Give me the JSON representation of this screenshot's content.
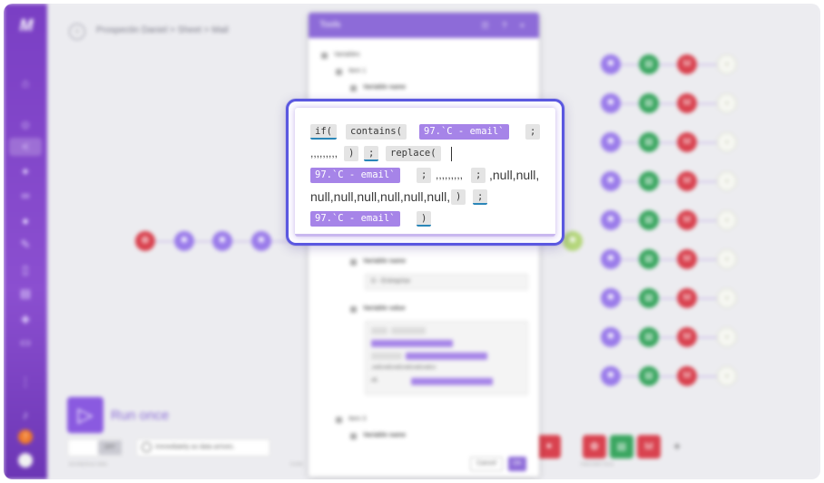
{
  "app": {
    "logo_text": "M",
    "breadcrumb": "Prospectin Daniel > Sheet > Mail"
  },
  "sidebar": {
    "icons": [
      "home-icon",
      "users-icon",
      "share-icon",
      "puzzle-icon",
      "link-icon",
      "globe-icon",
      "key-icon",
      "device-icon",
      "database-icon",
      "cube-icon",
      "book-icon",
      "more-icon",
      "bell-icon"
    ],
    "badge": "7"
  },
  "scenario": {
    "run_label": "Run once",
    "toggle_label": "OFF",
    "schedule_text": "Immediately as data arrives.",
    "scheduling_label": "SCHEDULING",
    "controls_label": "CON",
    "favorites_label": "FAVORITES",
    "node_label": "M",
    "gmail_node_label": "M"
  },
  "tools_panel": {
    "title": "Tools",
    "header_icons": "☷ ? ×",
    "variables_label": "Variables",
    "item1_label": "Item 1",
    "item3_label": "Item 3",
    "variable_name_label": "Variable name",
    "variable_value_label": "Variable value",
    "variable_name_value": "D - Entreprise",
    "mini_value_tail": ",null,null,null,null,null,null,n",
    "mini_value_end": "ull,",
    "cancel_label": "Cancel",
    "ok_label": "OK"
  },
  "formula": {
    "if_fn": "if(",
    "contains_fn": "contains(",
    "var_email": "97.`C - email`",
    "sep": ";",
    "commas": ",,,,,,,,,",
    "close_paren": ")",
    "replace_fn": "replace(",
    "null_tail_1": ",null,null,",
    "null_tail_2": "null,null,null,null,null,null,"
  },
  "colors": {
    "accent": "#8d6bd8",
    "focus_border": "#5b58e0",
    "variable_chip": "#a684e8",
    "function_chip": "#e4e4e4",
    "underline": "#2a86b8"
  }
}
